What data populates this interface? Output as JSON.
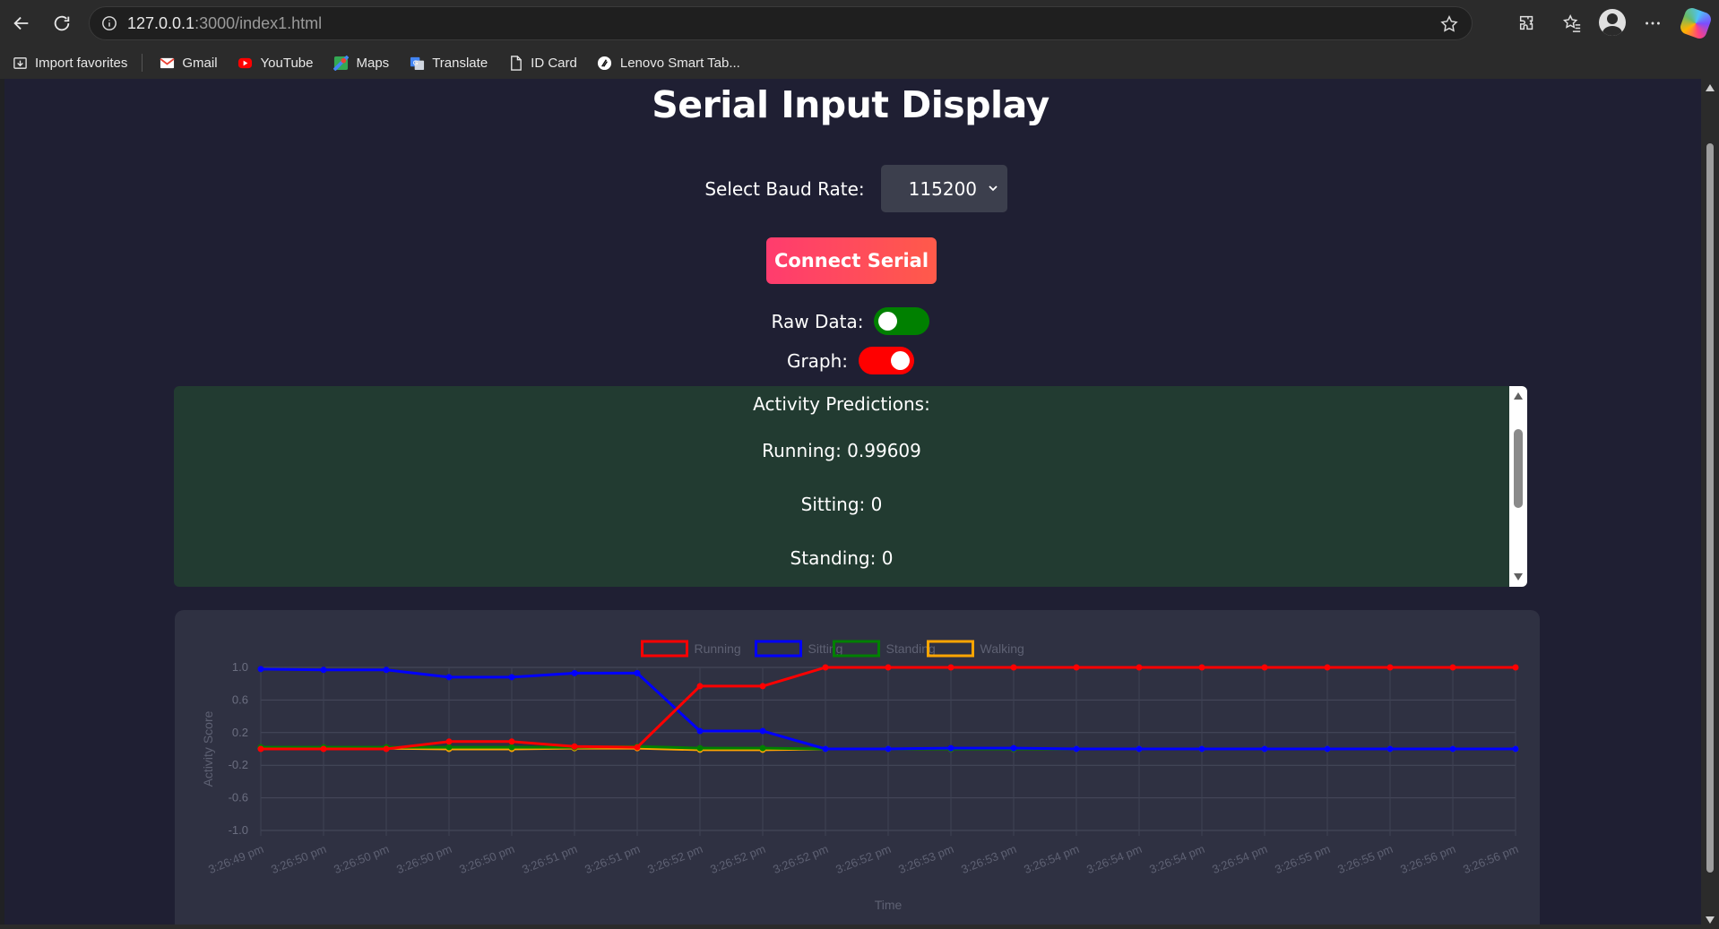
{
  "browser": {
    "url_host": "127.0.0.1",
    "url_rest": ":3000/index1.html",
    "bookmarks": [
      {
        "label": "Import favorites",
        "icon": "import-icon"
      },
      {
        "label": "Gmail",
        "icon": "gmail-icon"
      },
      {
        "label": "YouTube",
        "icon": "youtube-icon"
      },
      {
        "label": "Maps",
        "icon": "maps-icon"
      },
      {
        "label": "Translate",
        "icon": "translate-icon"
      },
      {
        "label": "ID Card",
        "icon": "document-icon"
      },
      {
        "label": "Lenovo Smart Tab...",
        "icon": "lenovo-icon"
      }
    ]
  },
  "page": {
    "title": "Serial Input Display",
    "baud_label": "Select Baud Rate:",
    "baud_value": "115200",
    "connect_label": "Connect Serial",
    "raw_label": "Raw Data:",
    "graph_label": "Graph:",
    "toggles": {
      "raw_on": true,
      "raw_color": "#008000",
      "graph_on": true,
      "graph_color": "#ff0000"
    },
    "predictions": {
      "heading": "Activity Predictions:",
      "lines": [
        "Running: 0.99609",
        "Sitting: 0",
        "Standing: 0"
      ]
    }
  },
  "colors": {
    "page_bg": "#1f1f33",
    "card_bg": "#2f3142",
    "pred_bg": "#223b31",
    "connect_gradient": [
      "#ff3c6e",
      "#ff5a4a"
    ]
  },
  "chart_data": {
    "type": "line",
    "xlabel": "Time",
    "ylabel": "Activity Score",
    "ylim": [
      -1.0,
      1.0
    ],
    "yticks": [
      1.0,
      0.6,
      0.2,
      -0.2,
      -0.6,
      -1.0
    ],
    "legend_position": "top-center",
    "grid": true,
    "x": [
      "3:26:49 pm",
      "3:26:50 pm",
      "3:26:50 pm",
      "3:26:50 pm",
      "3:26:50 pm",
      "3:26:51 pm",
      "3:26:51 pm",
      "3:26:52 pm",
      "3:26:52 pm",
      "3:26:52 pm",
      "3:26:52 pm",
      "3:26:53 pm",
      "3:26:53 pm",
      "3:26:54 pm",
      "3:26:54 pm",
      "3:26:54 pm",
      "3:26:54 pm",
      "3:26:55 pm",
      "3:26:55 pm",
      "3:26:56 pm",
      "3:26:56 pm"
    ],
    "series": [
      {
        "name": "Running",
        "color": "#ff0000",
        "values": [
          0.0,
          0.0,
          0.0,
          0.09,
          0.09,
          0.03,
          0.02,
          0.77,
          0.77,
          1.0,
          1.0,
          1.0,
          1.0,
          1.0,
          1.0,
          1.0,
          1.0,
          1.0,
          1.0,
          1.0,
          1.0
        ]
      },
      {
        "name": "Sitting",
        "color": "#0000ff",
        "values": [
          0.98,
          0.97,
          0.97,
          0.88,
          0.88,
          0.93,
          0.93,
          0.22,
          0.22,
          0.0,
          0.0,
          0.01,
          0.01,
          0.0,
          0.0,
          0.0,
          0.0,
          0.0,
          0.0,
          0.0,
          0.0
        ]
      },
      {
        "name": "Standing",
        "color": "#008000",
        "values": [
          0.02,
          0.02,
          0.02,
          0.02,
          0.02,
          0.02,
          0.03,
          0.01,
          0.01,
          0.0,
          0.0,
          0.0,
          0.0,
          0.0,
          0.0,
          0.0,
          0.0,
          0.0,
          0.0,
          0.0,
          0.0
        ]
      },
      {
        "name": "Walking",
        "color": "#ffa500",
        "values": [
          0.01,
          0.01,
          0.01,
          0.0,
          0.0,
          0.01,
          0.01,
          -0.01,
          -0.01,
          0.0,
          0.0,
          0.0,
          0.0,
          0.0,
          0.0,
          0.0,
          0.0,
          0.0,
          0.0,
          0.0,
          0.0
        ]
      }
    ]
  }
}
